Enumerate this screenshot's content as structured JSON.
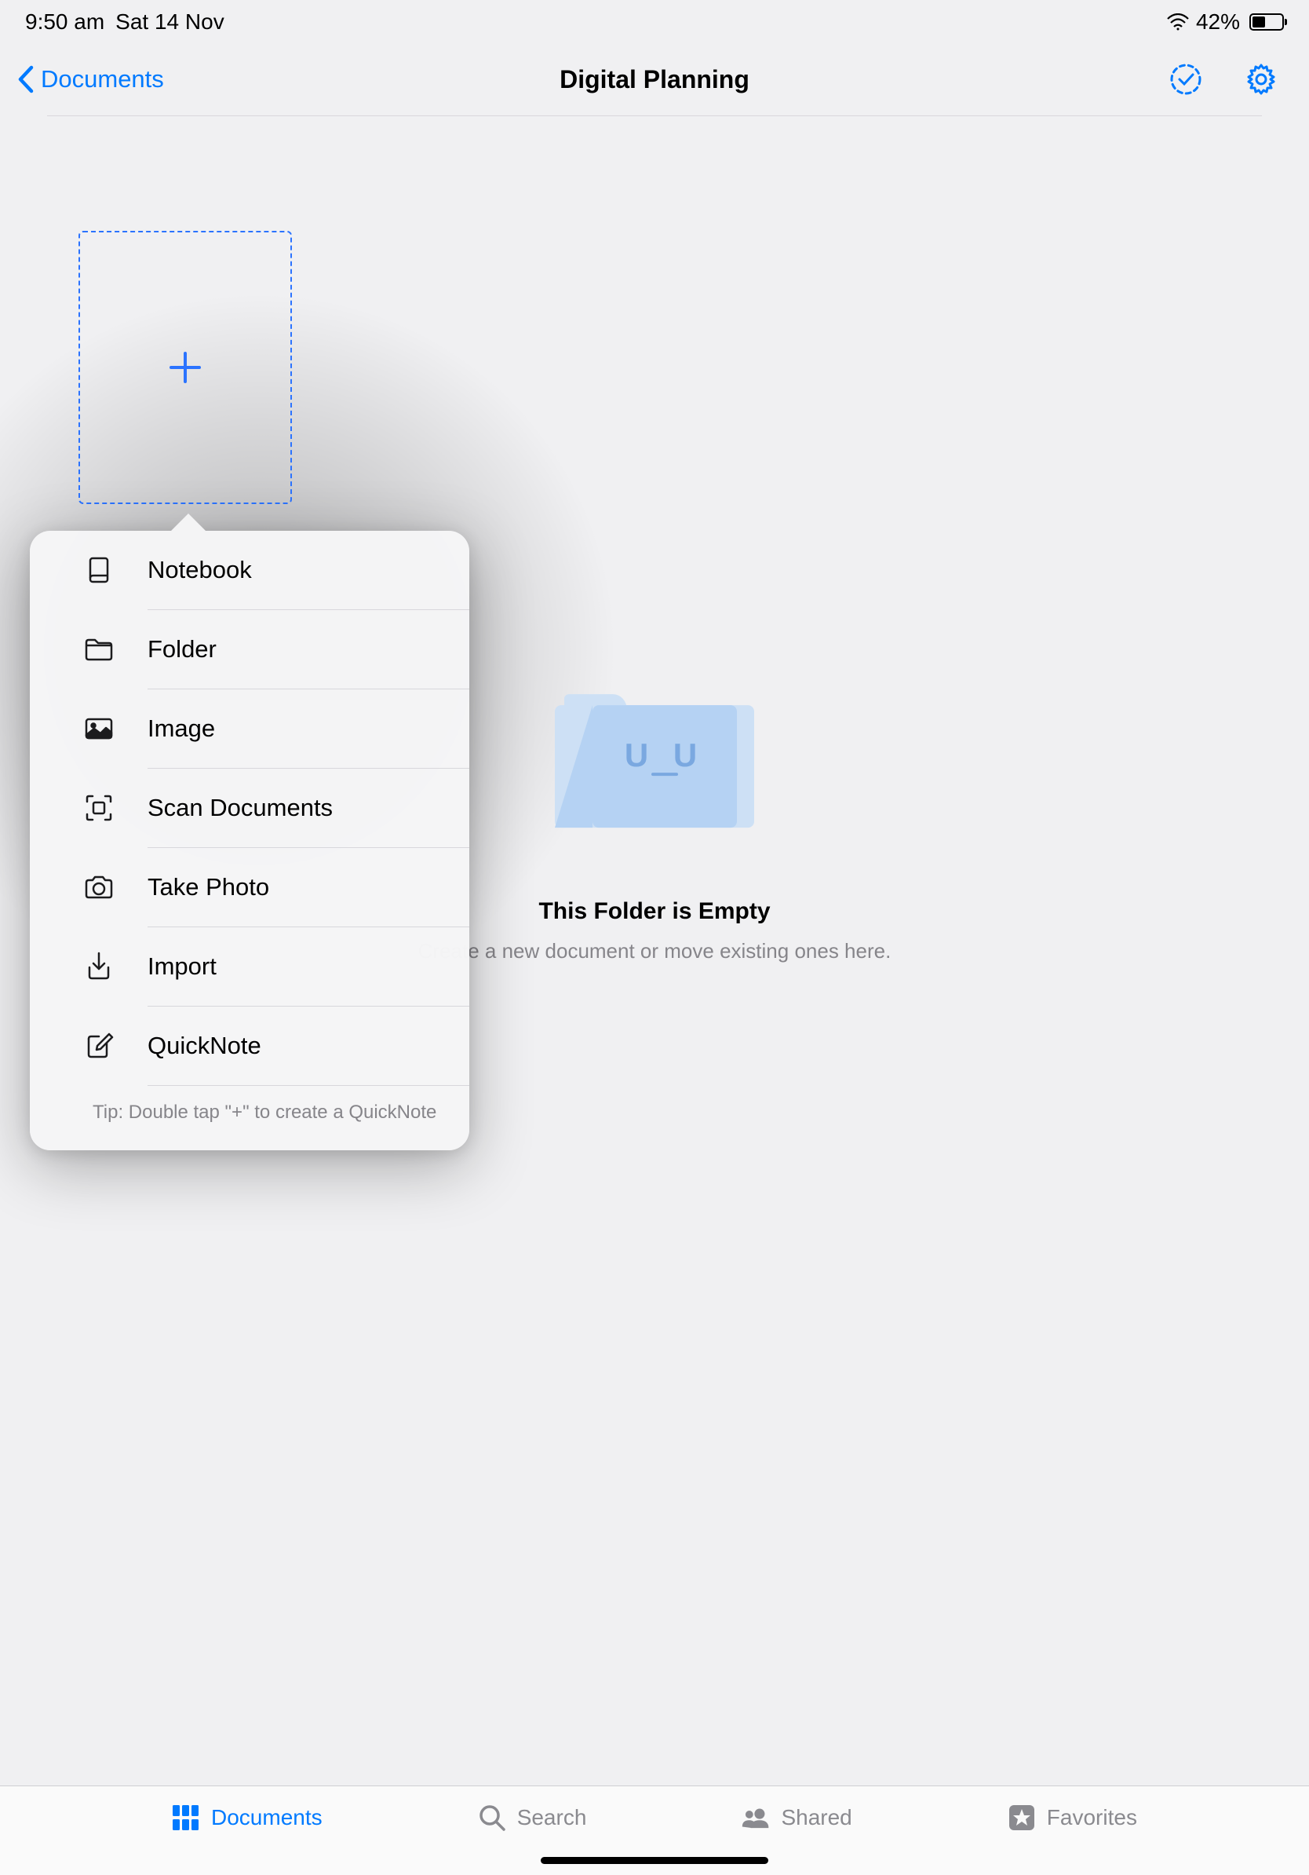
{
  "statusbar": {
    "time": "9:50 am",
    "date": "Sat 14 Nov",
    "battery_pct": "42%"
  },
  "nav": {
    "back_label": "Documents",
    "title": "Digital Planning"
  },
  "empty": {
    "title": "This Folder is Empty",
    "subtitle": "Create a new document or move existing ones here."
  },
  "popover": {
    "items": [
      {
        "label": "Notebook"
      },
      {
        "label": "Folder"
      },
      {
        "label": "Image"
      },
      {
        "label": "Scan Documents"
      },
      {
        "label": "Take Photo"
      },
      {
        "label": "Import"
      },
      {
        "label": "QuickNote"
      }
    ],
    "tip": "Tip: Double tap \"+\" to create a QuickNote"
  },
  "tabs": {
    "documents": "Documents",
    "search": "Search",
    "shared": "Shared",
    "favorites": "Favorites"
  }
}
